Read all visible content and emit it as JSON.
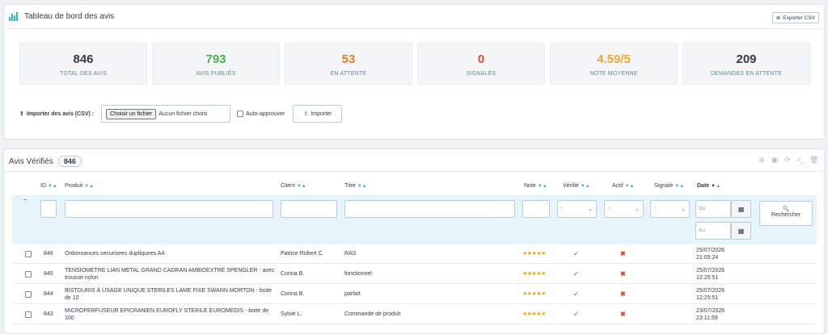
{
  "dashboard": {
    "title": "Tableau de bord des avis",
    "export_label": "Exporter CSV",
    "stats": [
      {
        "value": "846",
        "label": "TOTAL DES AVIS",
        "color": "#363a41"
      },
      {
        "value": "793",
        "label": "AVIS PUBLIÉS",
        "color": "#4caf50"
      },
      {
        "value": "53",
        "label": "EN ATTENTE",
        "color": "#e67e22"
      },
      {
        "value": "0",
        "label": "SIGNALÉS",
        "color": "#e74c3c"
      },
      {
        "value": "4.59/5",
        "label": "NOTE MOYENNE",
        "color": "#f0a830"
      },
      {
        "value": "209",
        "label": "DEMANDES EN ATTENTE",
        "color": "#363a41"
      }
    ],
    "import": {
      "label": "Importer des avis (CSV) :",
      "file_button": "Choisir un fichier",
      "file_status": "Aucun fichier choisi",
      "auto_approve": "Auto-approuver",
      "import_button": "Importer"
    }
  },
  "list": {
    "title": "Avis Vérifiés",
    "count": "846",
    "columns": [
      "ID",
      "Produit",
      "Client",
      "Titre",
      "Note",
      "Vérifié",
      "Actif",
      "Signalé",
      "Date"
    ],
    "filters": {
      "select_value": "-",
      "date_from": "Du",
      "date_to": "Au",
      "search_label": "Rechercher",
      "collapse": "–"
    },
    "rows": [
      {
        "id": "846",
        "product": "Ordonnances securisees dupliquees A4",
        "client": "Patrice Robert C.",
        "title": "RAS",
        "rating": 5,
        "verified": "✔",
        "active": "✖",
        "date": "25/07/2026",
        "time": "21:05:24"
      },
      {
        "id": "845",
        "product": "TENSIOMETRE LIAN METAL GRAND CADRAN AMBIDEXTRE SPENGLER - avec trousse nylon",
        "client": "Corina B.",
        "title": "fonctionnel",
        "rating": 5,
        "verified": "✔",
        "active": "✖",
        "date": "25/07/2026",
        "time": "12:25:51"
      },
      {
        "id": "844",
        "product": "BISTOURIS À USAGE UNIQUE STERILES LAME FIXE SWANN MORTON - boite de 10",
        "client": "Corina B.",
        "title": "parfait",
        "rating": 5,
        "verified": "✔",
        "active": "✖",
        "date": "25/07/2026",
        "time": "12:25:51"
      },
      {
        "id": "843",
        "product": "MICROPERFUSEUR EPICRANIEN EUROFLY STERILE EUROMEDIS - boite de 100",
        "client": "Sylvie L.",
        "title": "Commande de produit",
        "rating": 5,
        "verified": "✔",
        "active": "✖",
        "date": "23/07/2026",
        "time": "23:11:59"
      }
    ]
  }
}
